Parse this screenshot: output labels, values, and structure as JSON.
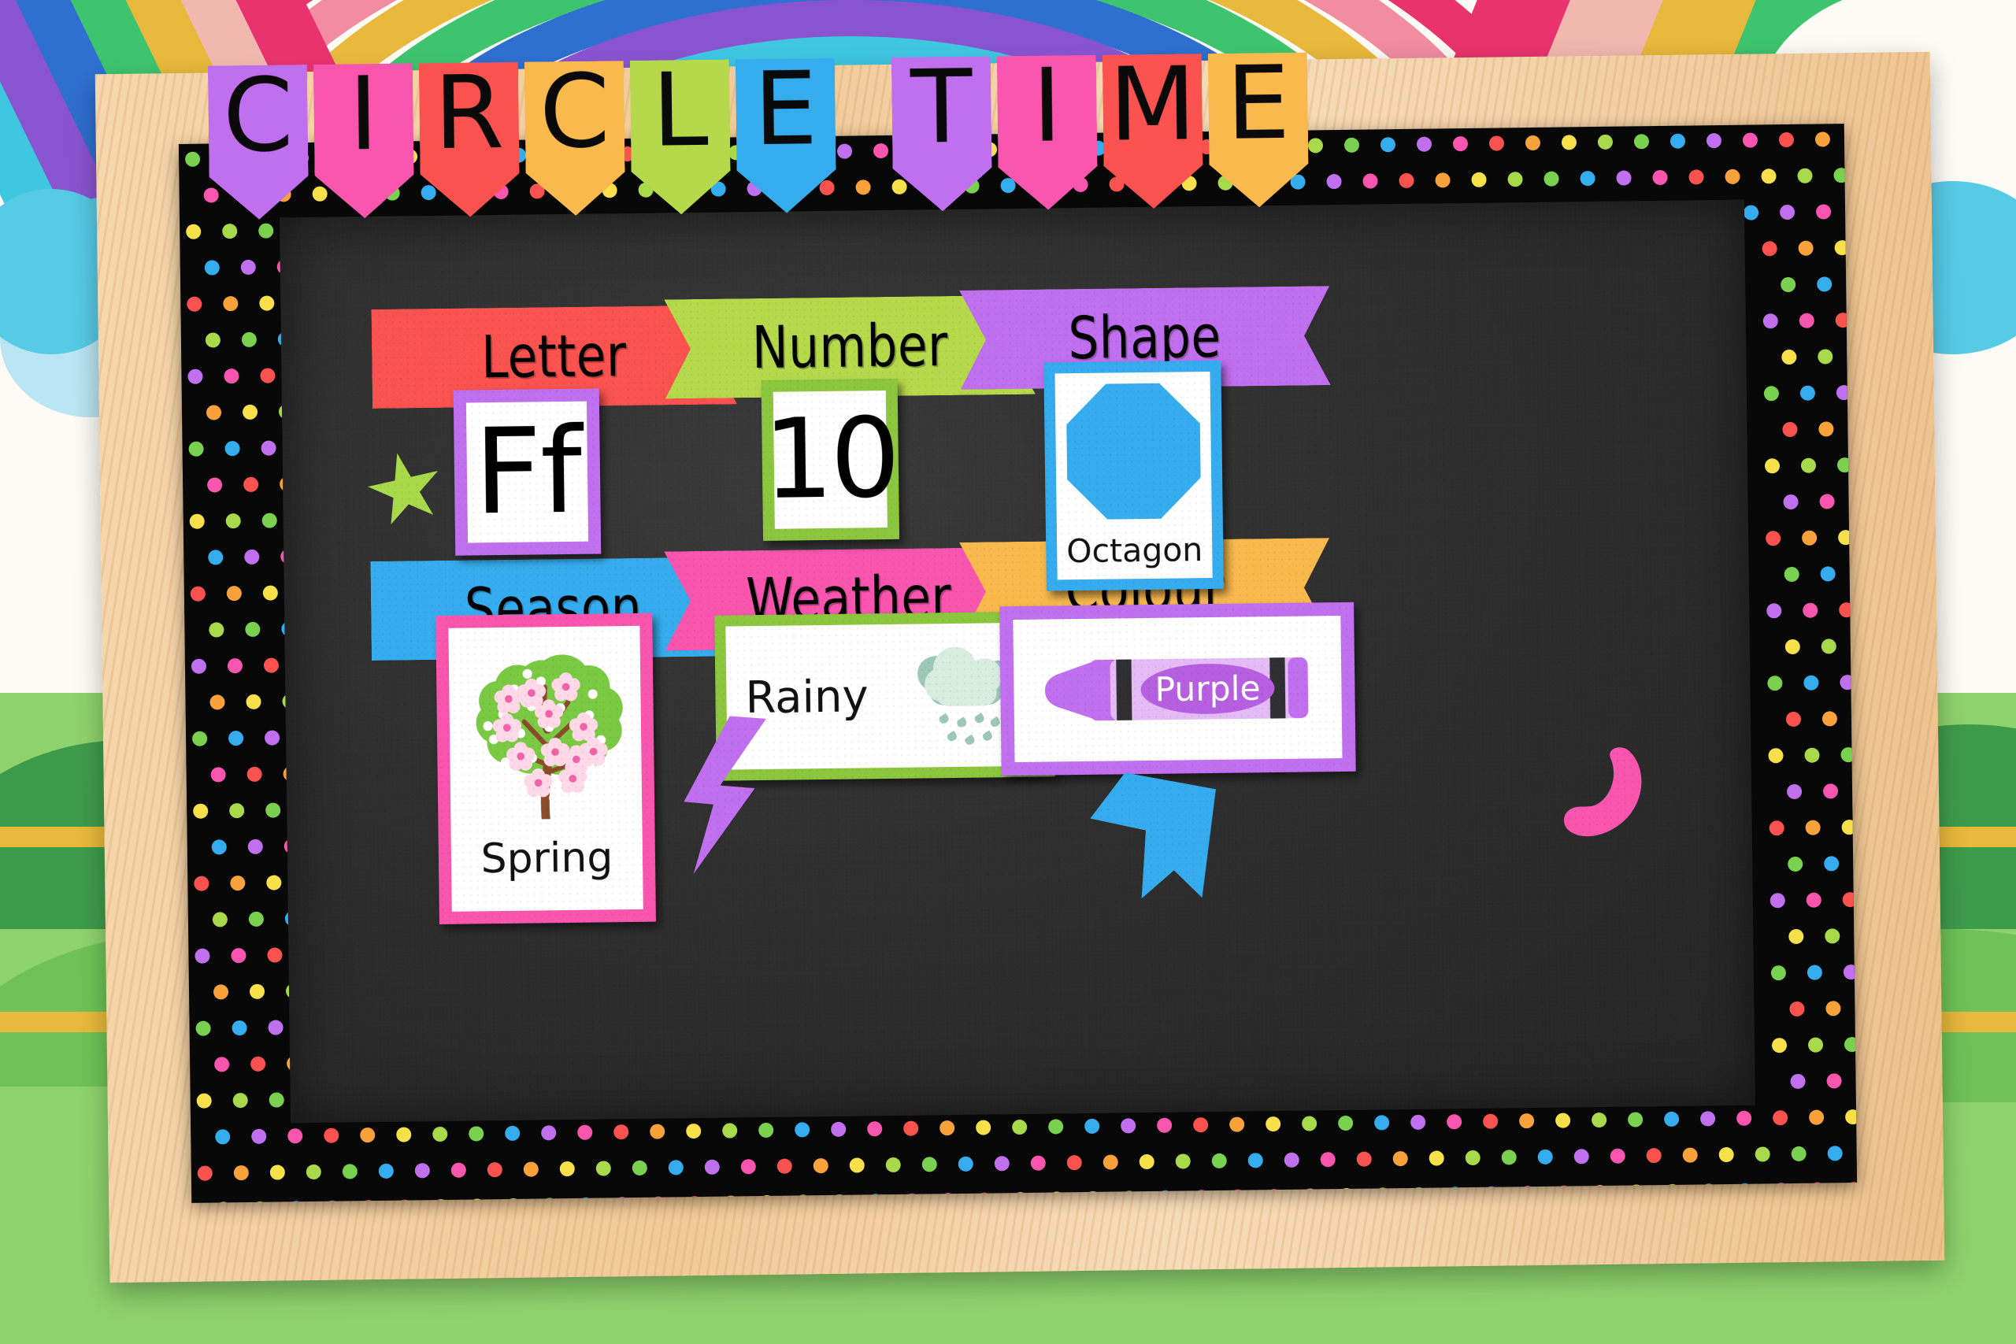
{
  "board": {
    "title": "CIRCLE TIME",
    "title_letters": [
      {
        "char": "C",
        "color": "#c06fee"
      },
      {
        "char": "I",
        "color": "#f855af"
      },
      {
        "char": "R",
        "color": "#f9524f"
      },
      {
        "char": "C",
        "color": "#f9b94c"
      },
      {
        "char": "L",
        "color": "#b5d94a"
      },
      {
        "char": "E",
        "color": "#35acee"
      },
      {
        "char": " ",
        "color": "none"
      },
      {
        "char": "T",
        "color": "#c06fee"
      },
      {
        "char": "I",
        "color": "#f855af"
      },
      {
        "char": "M",
        "color": "#f9524f"
      },
      {
        "char": "E",
        "color": "#f9b94c"
      }
    ],
    "frame_color": "#f2ca99",
    "board_color": "#2e2e2e",
    "dot_border_color": "#080808"
  },
  "sections": [
    {
      "key": "letter",
      "banner_label": "Letter",
      "banner_color": "#f9524f",
      "card": {
        "kind": "letter",
        "border_color": "#c06fee",
        "value": "Ff",
        "label": ""
      }
    },
    {
      "key": "number",
      "banner_label": "Number",
      "banner_color": "#b5d94a",
      "card": {
        "kind": "number",
        "border_color": "#8cc63e",
        "value": "10",
        "label": ""
      }
    },
    {
      "key": "shape",
      "banner_label": "Shape",
      "banner_color": "#c06fee",
      "card": {
        "kind": "shape",
        "border_color": "#35acee",
        "shape_name": "octagon",
        "shape_color": "#35acee",
        "value": "",
        "label": "Octagon"
      }
    },
    {
      "key": "season",
      "banner_label": "Season",
      "banner_color": "#35acee",
      "card": {
        "kind": "season",
        "border_color": "#f855af",
        "icon": "blossom-tree-icon",
        "value": "",
        "label": "Spring"
      }
    },
    {
      "key": "weather",
      "banner_label": "Weather",
      "banner_color": "#f855af",
      "card": {
        "kind": "weather",
        "border_color": "#8cc63e",
        "icon": "rain-cloud-icon",
        "value": "",
        "label": "Rainy"
      }
    },
    {
      "key": "colour",
      "banner_label": "Colour",
      "banner_color": "#f9b94c",
      "card": {
        "kind": "colour",
        "border_color": "#c06fee",
        "icon": "crayon-icon",
        "crayon_color": "#c06fee",
        "value": "",
        "label": "Purple"
      }
    }
  ],
  "decorations": [
    {
      "name": "star-shape",
      "color": "#a8d94a"
    },
    {
      "name": "lightning-bolt-shape",
      "color": "#c06fee"
    },
    {
      "name": "chevron-arrow-shape",
      "color": "#35acee"
    },
    {
      "name": "crescent-shape",
      "color": "#f855af"
    }
  ],
  "dot_palette": [
    "#7ad14f",
    "#35acee",
    "#c06fee",
    "#f855af",
    "#f9524f",
    "#f9a23c",
    "#f7e04a",
    "#a8d94a"
  ],
  "background": {
    "sky_color": "#fdfbf5",
    "grass_color": "#8ed36d",
    "rainbow_colors": [
      "#e8336e",
      "#f28ca0",
      "#e8b93c",
      "#3ec46f",
      "#2f6fd0",
      "#8a54d0",
      "#3fc7e0"
    ]
  }
}
